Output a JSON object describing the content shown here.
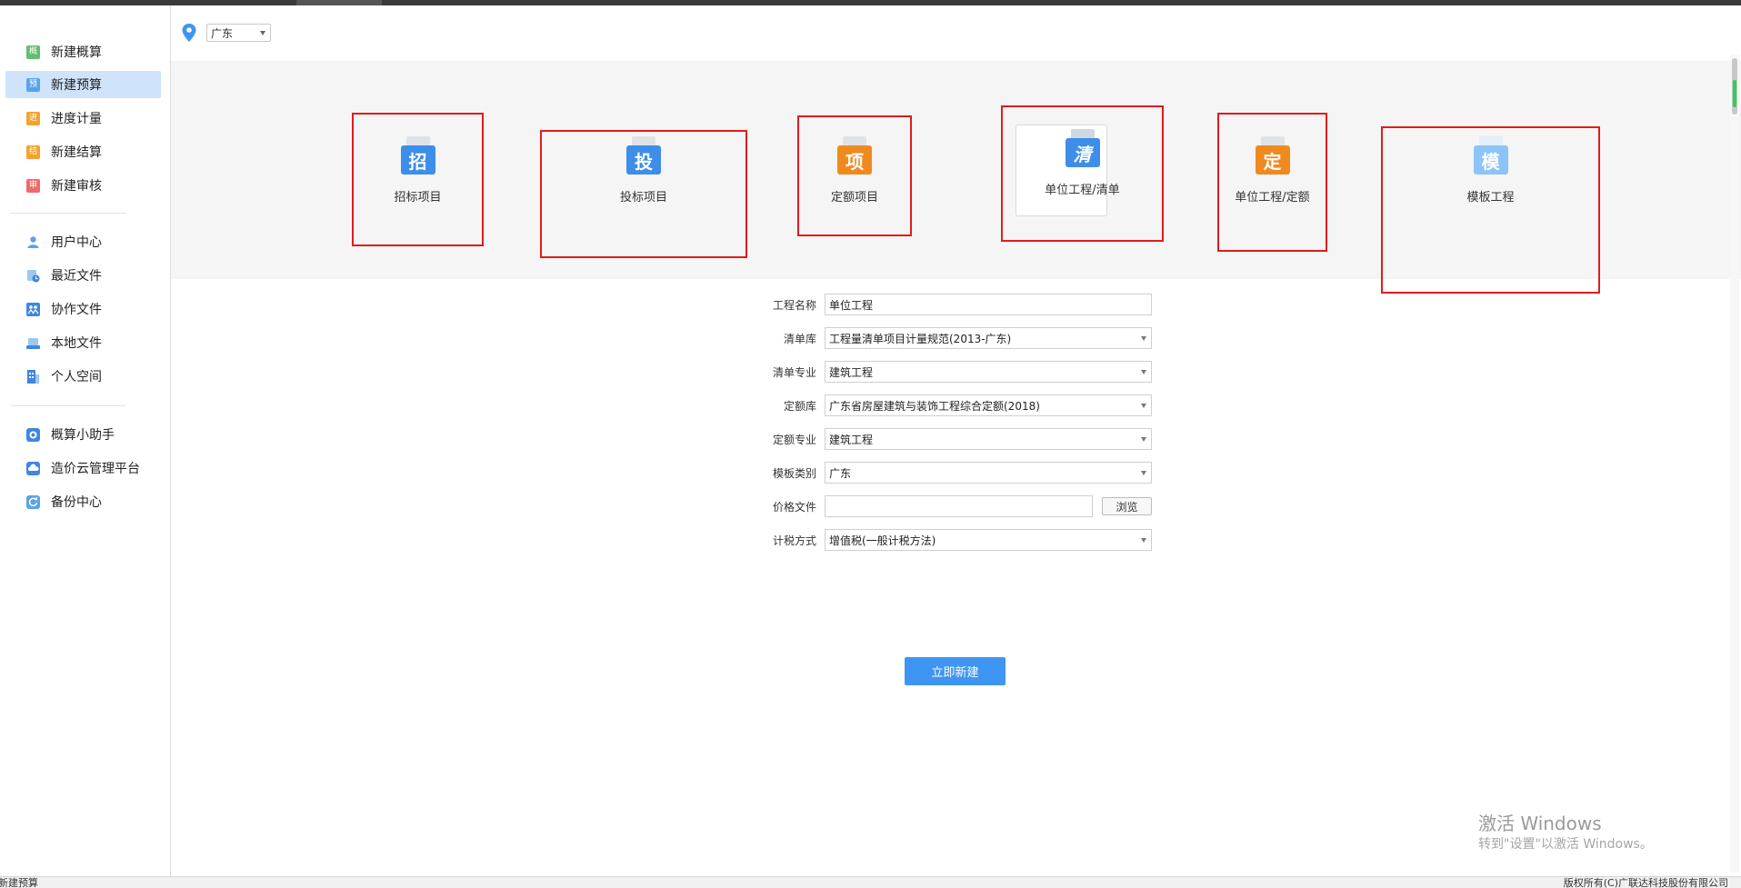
{
  "sidebar": {
    "items": [
      {
        "label": "新建概算",
        "icon": "概",
        "color": "#5fbf6a"
      },
      {
        "label": "新建预算",
        "icon": "预",
        "color": "#59a4e8",
        "active": true
      },
      {
        "label": "进度计量",
        "icon": "进",
        "color": "#f2a32e"
      },
      {
        "label": "新建结算",
        "icon": "结",
        "color": "#f2a32e"
      },
      {
        "label": "新建审核",
        "icon": "审",
        "color": "#ef6b6b"
      },
      {
        "label": "用户中心",
        "icon": "user-icon",
        "color": "#5aa2ea"
      },
      {
        "label": "最近文件",
        "icon": "recent-icon",
        "color": "#5aa2ea"
      },
      {
        "label": "协作文件",
        "icon": "collab-icon",
        "color": "#3f86e0"
      },
      {
        "label": "本地文件",
        "icon": "local-icon",
        "color": "#5aa2ea"
      },
      {
        "label": "个人空间",
        "icon": "space-icon",
        "color": "#3f86e0"
      },
      {
        "label": "概算小助手",
        "icon": "assistant-icon",
        "color": "#3f86e0"
      },
      {
        "label": "造价云管理平台",
        "icon": "cloud-icon",
        "color": "#3f86e0"
      },
      {
        "label": "备份中心",
        "icon": "backup-icon",
        "color": "#5aa2ea"
      }
    ]
  },
  "location": {
    "value": "广东"
  },
  "project_types": [
    {
      "label": "招标项目",
      "glyph": "招",
      "color": "#3d8ee8"
    },
    {
      "label": "投标项目",
      "glyph": "投",
      "color": "#3d8ee8"
    },
    {
      "label": "定额项目",
      "glyph": "项",
      "color": "#f08a1e"
    },
    {
      "label": "单位工程/清单",
      "glyph": "清",
      "color": "#3d8ee8"
    },
    {
      "label": "单位工程/定额",
      "glyph": "定",
      "color": "#f08a1e"
    },
    {
      "label": "模板工程",
      "glyph": "模",
      "color": "#8cc4f7"
    }
  ],
  "form": {
    "project_name": {
      "label": "工程名称",
      "value": "单位工程"
    },
    "bill_library": {
      "label": "清单库",
      "value": "工程量清单项目计量规范(2013-广东)"
    },
    "bill_specialty": {
      "label": "清单专业",
      "value": "建筑工程"
    },
    "quota_library": {
      "label": "定额库",
      "value": "广东省房屋建筑与装饰工程综合定额(2018)"
    },
    "quota_specialty": {
      "label": "定额专业",
      "value": "建筑工程"
    },
    "template_category": {
      "label": "模板类别",
      "value": "广东"
    },
    "price_file": {
      "label": "价格文件",
      "value": "",
      "browse": "浏览"
    },
    "tax_method": {
      "label": "计税方式",
      "value": "增值税(一般计税方法)"
    }
  },
  "create_button": "立即新建",
  "watermark": {
    "title": "激活 Windows",
    "subtitle": "转到\"设置\"以激活 Windows。"
  },
  "statusbar": {
    "left": "新建预算",
    "right": "版权所有(C)广联达科技股份有限公司"
  }
}
